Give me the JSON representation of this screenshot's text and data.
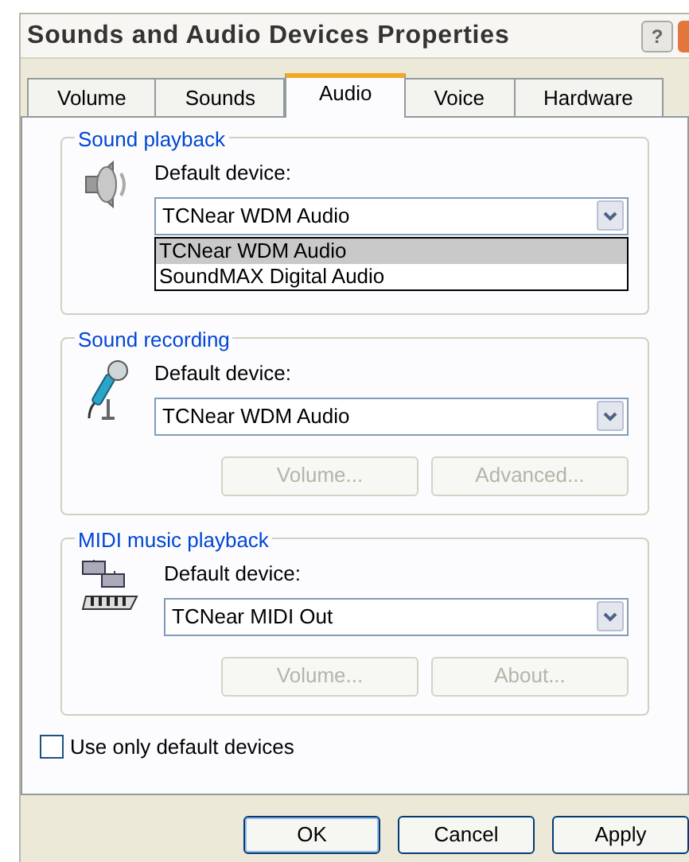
{
  "window": {
    "title": "Sounds and Audio Devices Properties",
    "help_button": "?"
  },
  "tabs": [
    {
      "label": "Volume",
      "selected": false
    },
    {
      "label": "Sounds",
      "selected": false
    },
    {
      "label": "Audio",
      "selected": true
    },
    {
      "label": "Voice",
      "selected": false
    },
    {
      "label": "Hardware",
      "selected": false
    }
  ],
  "groups": [
    {
      "title": "Sound playback",
      "device_label": "Default device:",
      "device": "TCNear WDM Audio",
      "options": [
        {
          "label": "TCNear WDM Audio",
          "selected": true
        },
        {
          "label": "SoundMAX Digital Audio",
          "selected": false
        }
      ]
    },
    {
      "title": "Sound recording",
      "device_label": "Default device:",
      "device": "TCNear WDM Audio",
      "buttons": [
        {
          "label": "Volume...",
          "disabled": true
        },
        {
          "label": "Advanced...",
          "disabled": true
        }
      ]
    },
    {
      "title": "MIDI music playback",
      "device_label": "Default device:",
      "device": "TCNear MIDI Out",
      "buttons": [
        {
          "label": "Volume...",
          "disabled": true
        },
        {
          "label": "About...",
          "disabled": true
        }
      ]
    }
  ],
  "use_only_default": {
    "label": "Use only default devices",
    "checked": false
  },
  "buttons": [
    {
      "label": "OK",
      "disabled": false
    },
    {
      "label": "Cancel",
      "disabled": false
    },
    {
      "label": "Apply",
      "disabled": false
    }
  ]
}
